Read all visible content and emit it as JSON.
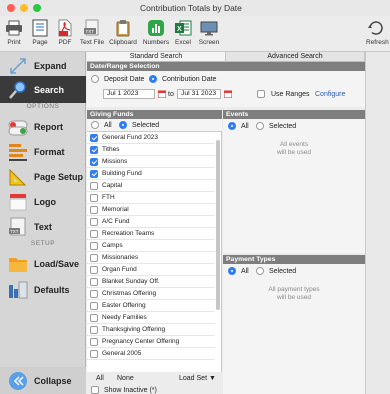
{
  "window": {
    "title": "Contribution Totals by Date"
  },
  "toolbar": {
    "buttons": [
      {
        "label": "Print",
        "icon": "printer-icon"
      },
      {
        "label": "Page",
        "icon": "page-setup-icon"
      },
      {
        "label": "PDF",
        "icon": "pdf-icon"
      },
      {
        "label": "Text File",
        "icon": "text-file-icon"
      },
      {
        "label": "Clipboard",
        "icon": "clipboard-icon"
      },
      {
        "label": "Numbers",
        "icon": "numbers-icon"
      },
      {
        "label": "Excel",
        "icon": "excel-icon"
      },
      {
        "label": "Screen",
        "icon": "screen-icon"
      },
      {
        "label": "Refresh",
        "icon": "refresh-icon"
      }
    ]
  },
  "sidebar": {
    "items": [
      {
        "label": "Expand",
        "icon": "expand-icon"
      },
      {
        "label": "Search",
        "icon": "search-icon",
        "active": true
      },
      {
        "label": "Report",
        "icon": "report-icon"
      },
      {
        "label": "Format",
        "icon": "format-icon"
      },
      {
        "label": "Page Setup",
        "icon": "page-setup-icon"
      },
      {
        "label": "Logo",
        "icon": "logo-icon"
      },
      {
        "label": "Text",
        "icon": "text-icon"
      },
      {
        "label": "Load/Save",
        "icon": "folder-icon"
      },
      {
        "label": "Defaults",
        "icon": "defaults-icon"
      },
      {
        "label": "Collapse",
        "icon": "collapse-icon"
      }
    ],
    "sections": {
      "options": "OPTIONS",
      "setup": "SETUP"
    }
  },
  "tabs": [
    {
      "label": "Standard Search",
      "active": true
    },
    {
      "label": "Advanced Search",
      "active": false
    }
  ],
  "date_range": {
    "header": "Date/Range Selection",
    "deposit_label": "Deposit Date",
    "contribution_label": "Contribution Date",
    "selected": "contribution",
    "from": "Jul 1 2023",
    "to_label": "to",
    "to": "Jul 31 2023",
    "use_ranges_label": "Use Ranges",
    "configure_label": "Configure"
  },
  "giving_funds": {
    "header": "Giving Funds",
    "all_label": "All",
    "selected_label": "Selected",
    "selected_mode": "selected",
    "funds": [
      {
        "name": "General Fund 2023",
        "checked": true
      },
      {
        "name": "Tithes",
        "checked": true
      },
      {
        "name": "Missions",
        "checked": true
      },
      {
        "name": "Building Fund",
        "checked": true
      },
      {
        "name": "Capital",
        "checked": false
      },
      {
        "name": "FTH",
        "checked": false
      },
      {
        "name": "Memorial",
        "checked": false
      },
      {
        "name": "A/C Fund",
        "checked": false
      },
      {
        "name": "Recreation Teams",
        "checked": false
      },
      {
        "name": "Camps",
        "checked": false
      },
      {
        "name": "Missionaries",
        "checked": false
      },
      {
        "name": "Organ Fund",
        "checked": false
      },
      {
        "name": "Blanket Sunday Off.",
        "checked": false
      },
      {
        "name": "Christmas Offering",
        "checked": false
      },
      {
        "name": "Easter Offering",
        "checked": false
      },
      {
        "name": "Needy Families",
        "checked": false
      },
      {
        "name": "Thanksgiving Offering",
        "checked": false
      },
      {
        "name": "Pregnancy Center Offering",
        "checked": false
      },
      {
        "name": "General 2005",
        "checked": false
      }
    ],
    "footer": {
      "all": "All",
      "none": "None",
      "load_set": "Load Set ▼",
      "show_inactive": "Show Inactive (*)"
    }
  },
  "events": {
    "header": "Events",
    "all_label": "All",
    "selected_label": "Selected",
    "note_line1": "All events",
    "note_line2": "will be used"
  },
  "payment_types": {
    "header": "Payment Types",
    "all_label": "All",
    "selected_label": "Selected",
    "note_line1": "All payment types",
    "note_line2": "will be used"
  }
}
